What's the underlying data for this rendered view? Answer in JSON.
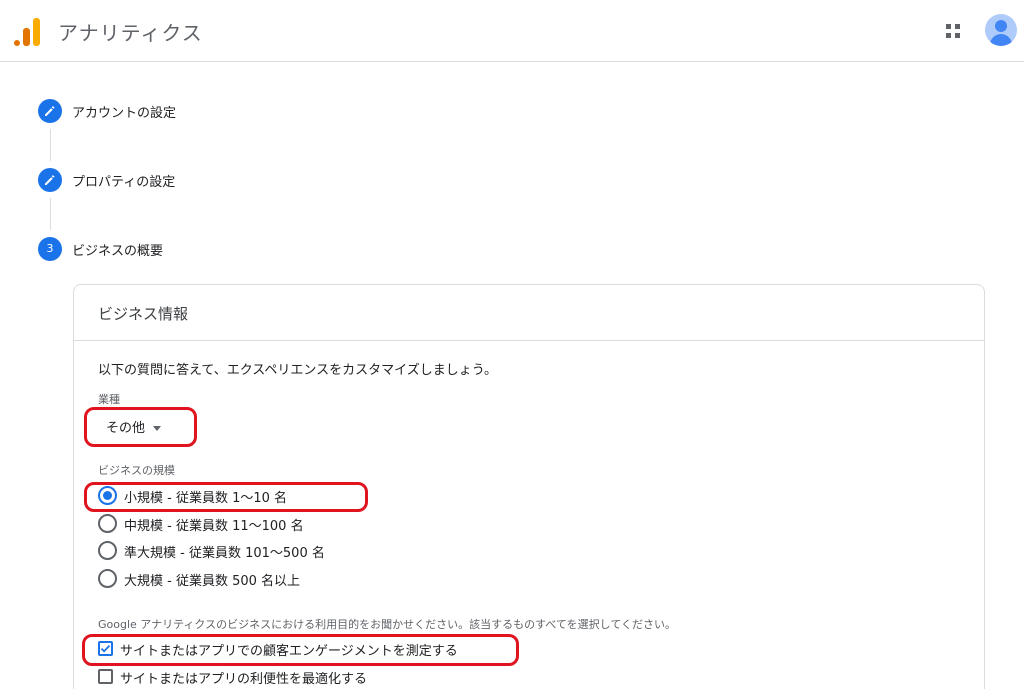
{
  "header": {
    "app_title": "アナリティクス",
    "logo_icon": "analytics-logo-icon",
    "apps_icon": "apps-grid-icon",
    "avatar_icon": "account-avatar-icon"
  },
  "steps": [
    {
      "label": "アカウントの設定",
      "icon": "pencil-icon",
      "status": "done"
    },
    {
      "label": "プロパティの設定",
      "icon": "pencil-icon",
      "status": "done"
    },
    {
      "number": "3",
      "label": "ビジネスの概要",
      "status": "current"
    }
  ],
  "business_info": {
    "title": "ビジネス情報",
    "intro": "以下の質問に答えて、エクスペリエンスをカスタマイズしましょう。",
    "industry": {
      "label": "業種",
      "selected": "その他"
    },
    "size": {
      "label": "ビジネスの規模",
      "options": [
        {
          "label": "小規模 - 従業員数 1～10 名",
          "selected": true
        },
        {
          "label": "中規模 - 従業員数 11～100 名",
          "selected": false
        },
        {
          "label": "準大規模 - 従業員数 101～500 名",
          "selected": false
        },
        {
          "label": "大規模 - 従業員数 500 名以上",
          "selected": false
        }
      ]
    },
    "usage": {
      "label": "Google アナリティクスのビジネスにおける利用目的をお聞かせください。該当するものすべてを選択してください。",
      "options": [
        {
          "label": "サイトまたはアプリでの顧客エンゲージメントを測定する",
          "checked": true
        },
        {
          "label": "サイトまたはアプリの利便性を最適化する",
          "checked": false
        }
      ]
    }
  },
  "colors": {
    "accent": "#1a73e8",
    "highlight": "#e0141e"
  }
}
